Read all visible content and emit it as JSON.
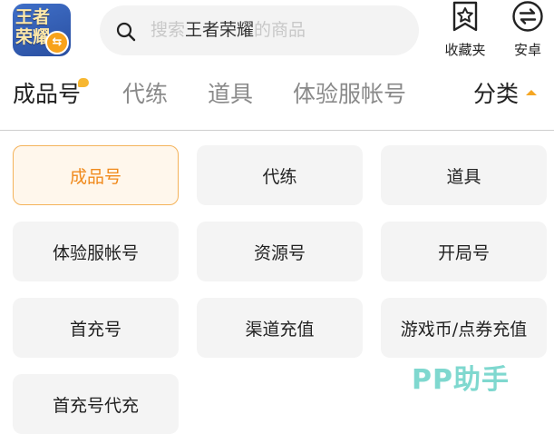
{
  "app": {
    "logo_text": "王者荣耀",
    "badge": "⇆"
  },
  "search": {
    "prefix": "搜索",
    "keyword": "王者荣耀",
    "suffix": "的商品"
  },
  "top_actions": {
    "favorites_label": "收藏夹",
    "android_label": "安卓"
  },
  "tabs": [
    {
      "label": "成品号",
      "active": true
    },
    {
      "label": "代练",
      "active": false
    },
    {
      "label": "道具",
      "active": false
    },
    {
      "label": "体验服帐号",
      "active": false
    }
  ],
  "category": {
    "label": "分类"
  },
  "grid": [
    {
      "label": "成品号",
      "selected": true
    },
    {
      "label": "代练"
    },
    {
      "label": "道具"
    },
    {
      "label": "体验服帐号"
    },
    {
      "label": "资源号"
    },
    {
      "label": "开局号"
    },
    {
      "label": "首充号"
    },
    {
      "label": "渠道充值"
    },
    {
      "label": "游戏币/点券充值"
    },
    {
      "label": "首充号代充"
    }
  ],
  "watermark": "PP助手",
  "colors": {
    "accent": "#f08a1c",
    "accent_border": "#f4b35b",
    "watermark": "#7fd8cf"
  }
}
